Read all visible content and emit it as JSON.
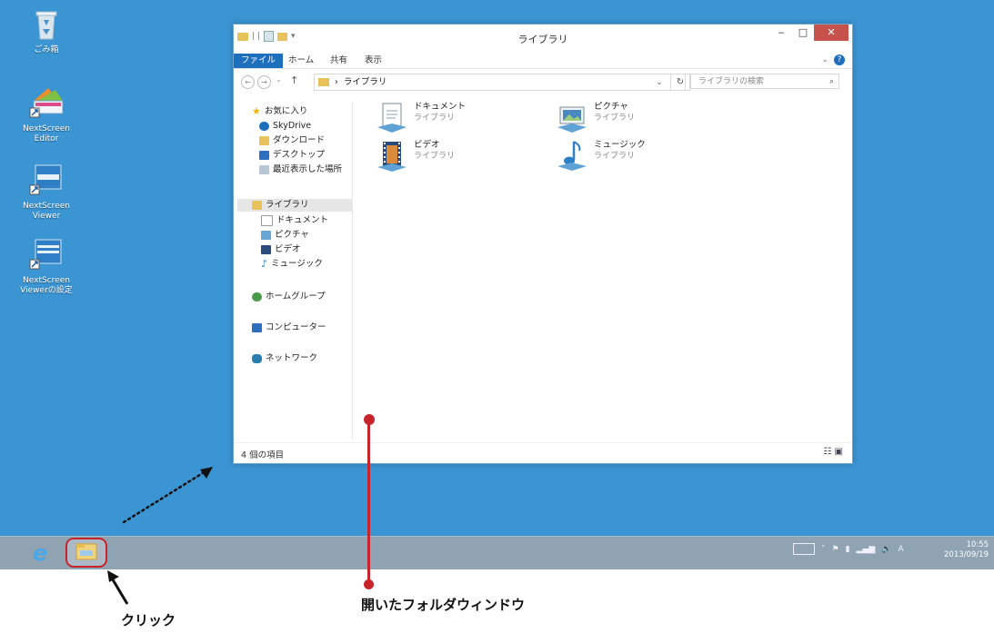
{
  "colors": {
    "desktop": "#3b95d3",
    "accent": "#1f6fbf",
    "annotation": "#c7242b",
    "close": "#c7514b"
  },
  "desktop": {
    "icons": [
      {
        "label": "ごみ箱",
        "icon": "recycle-bin-icon"
      },
      {
        "label": "NextScreen\nEditor",
        "icon": "nextscreen-editor-icon"
      },
      {
        "label": "NextScreen\nViewer",
        "icon": "nextscreen-viewer-icon"
      },
      {
        "label": "NextScreen\nViewerの設定",
        "icon": "nextscreen-viewer-settings-icon"
      }
    ]
  },
  "window": {
    "title": "ライブラリ",
    "qat_sep": "| |",
    "ribbon_tabs": [
      "ファイル",
      "ホーム",
      "共有",
      "表示"
    ],
    "address": "ライブラリ",
    "address_sep": "›",
    "search_placeholder": "ライブラリの検索",
    "nav": {
      "favorites": "お気に入り",
      "favorites_items": [
        "SkyDrive",
        "ダウンロード",
        "デスクトップ",
        "最近表示した場所"
      ],
      "libraries": "ライブラリ",
      "libraries_items": [
        "ドキュメント",
        "ピクチャ",
        "ビデオ",
        "ミュージック"
      ],
      "homegroup": "ホームグループ",
      "computer": "コンピューター",
      "network": "ネットワーク"
    },
    "items": [
      {
        "name": "ドキュメント",
        "type": "ライブラリ",
        "icon": "documents-library-icon"
      },
      {
        "name": "ピクチャ",
        "type": "ライブラリ",
        "icon": "pictures-library-icon"
      },
      {
        "name": "ビデオ",
        "type": "ライブラリ",
        "icon": "videos-library-icon"
      },
      {
        "name": "ミュージック",
        "type": "ライブラリ",
        "icon": "music-library-icon"
      }
    ],
    "status": "4 個の項目"
  },
  "taskbar": {
    "clock_time": "10:55",
    "clock_date": "2013/09/19",
    "ime": "A"
  },
  "annotations": {
    "click": "クリック",
    "opened": "開いたフォルダウィンドウ"
  }
}
